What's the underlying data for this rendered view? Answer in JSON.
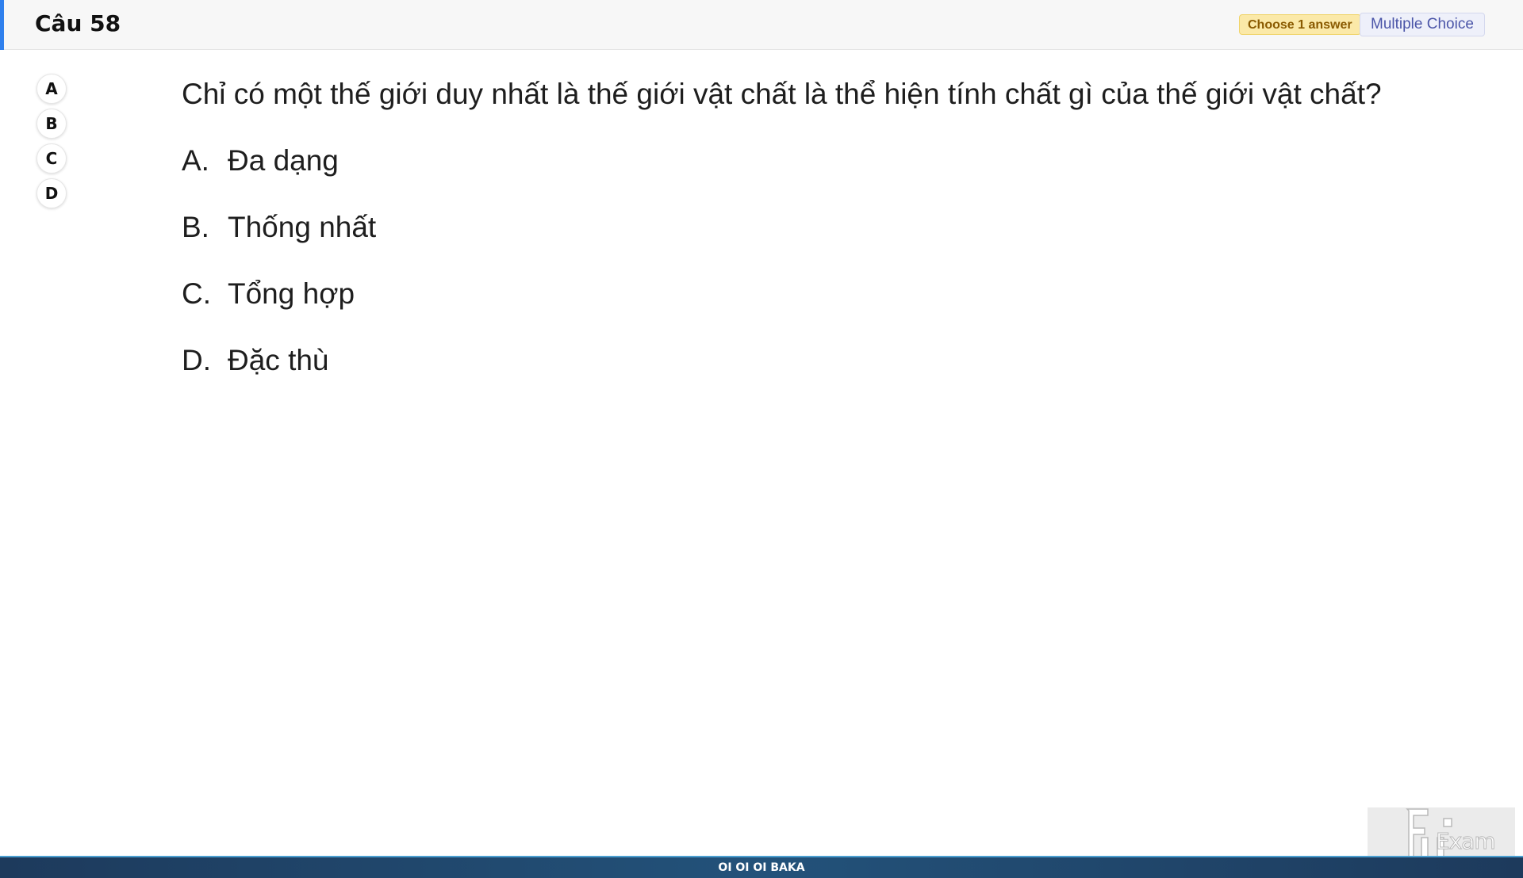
{
  "header": {
    "title": "Câu 58",
    "choose_badge": "Choose 1 answer",
    "type_badge": "Multiple Choice",
    "accent_color": "#2f80ed"
  },
  "selector": {
    "options": [
      "A",
      "B",
      "C",
      "D"
    ]
  },
  "question": {
    "text": "Chỉ có một thế giới duy nhất là thế giới vật chất là thể hiện tính chất gì của thế giới vật chất?",
    "choices": [
      {
        "letter": "A.",
        "text": "Đa dạng"
      },
      {
        "letter": "B.",
        "text": "Thống nhất"
      },
      {
        "letter": "C.",
        "text": "Tổng hợp"
      },
      {
        "letter": "D.",
        "text": "Đặc thù"
      }
    ]
  },
  "footer": {
    "text": "OI OI OI BAKA"
  },
  "logo": {
    "icon": "fu-exam-logo",
    "text": "Exam"
  }
}
